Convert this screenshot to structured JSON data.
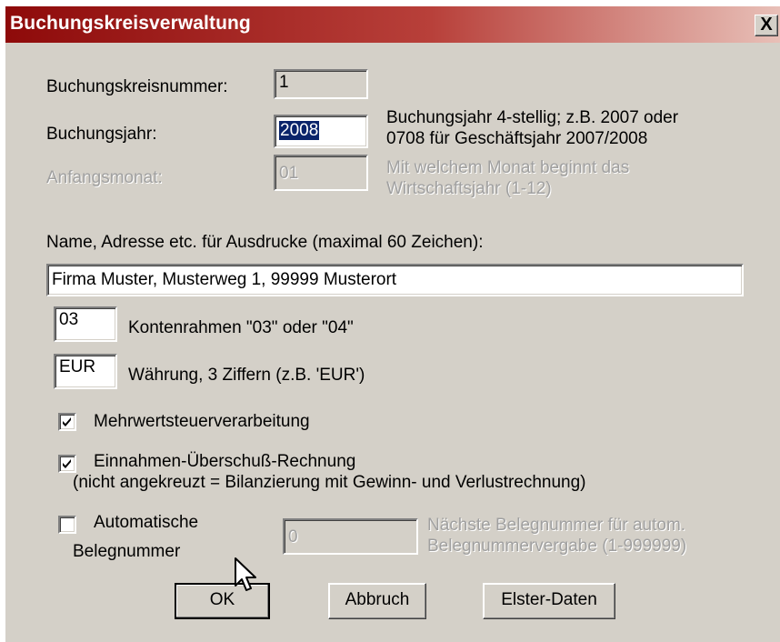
{
  "window": {
    "title": "Buchungskreisverwaltung",
    "close_label": "X"
  },
  "fields": {
    "buchungskreisnummer": {
      "label": "Buchungskreisnummer:",
      "value": "1"
    },
    "buchungsjahr": {
      "label": "Buchungsjahr:",
      "value": "2008",
      "hint_line1": "Buchungsjahr 4-stellig; z.B. 2007 oder",
      "hint_line2": "0708 für Geschäftsjahr 2007/2008"
    },
    "anfangsmonat": {
      "label": "Anfangsmonat:",
      "value": "01",
      "hint_line1": "Mit welchem Monat beginnt das",
      "hint_line2": "Wirtschaftsjahr (1-12)"
    },
    "name": {
      "label": "Name, Adresse etc. für Ausdrucke (maximal 60 Zeichen):",
      "value": "Firma Muster, Musterweg 1, 99999 Musterort"
    },
    "kontenrahmen": {
      "value": "03",
      "label": "Kontenrahmen \"03\" oder \"04\""
    },
    "waehrung": {
      "value": "EUR",
      "label": "Währung,  3 Ziffern (z.B. 'EUR')"
    }
  },
  "checkboxes": {
    "mwst": {
      "label": "Mehrwertsteuerverarbeitung",
      "checked": true
    },
    "eur": {
      "label": "Einnahmen-Überschuß-Rechnung",
      "sublabel": "(nicht angekreuzt = Bilanzierung mit Gewinn- und Verlustrechnung)",
      "checked": true
    },
    "auto_beleg": {
      "label_line1": "Automatische",
      "label_line2": "Belegnummer",
      "checked": false
    }
  },
  "belegnummer": {
    "value": "0",
    "hint_line1": "Nächste Belegnummer für autom.",
    "hint_line2": "Belegnummervergabe (1-999999)"
  },
  "buttons": {
    "ok": "OK",
    "abbruch": "Abbruch",
    "elster": "Elster-Daten"
  },
  "colors": {
    "title_start": "#8e0a0a",
    "face": "#d4d0c8",
    "selection": "#0a246a"
  }
}
